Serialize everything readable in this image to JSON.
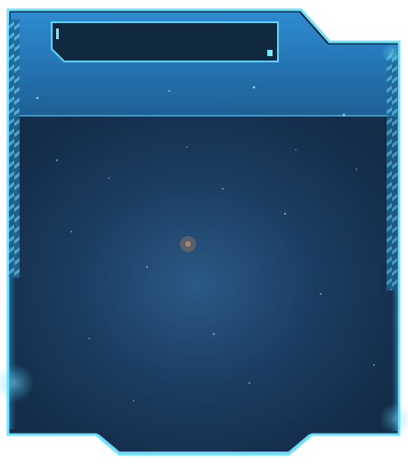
{
  "panel": {
    "title": "",
    "colors": {
      "frame_glow": "#3fd0ff",
      "frame_edge": "#1fa9e6",
      "header_bg": "#1d6aa3",
      "body_bg": "#16314f",
      "title_bar_bg": "#0f2840",
      "stripe": "#4fa9d4"
    }
  },
  "content": {
    "items": []
  }
}
